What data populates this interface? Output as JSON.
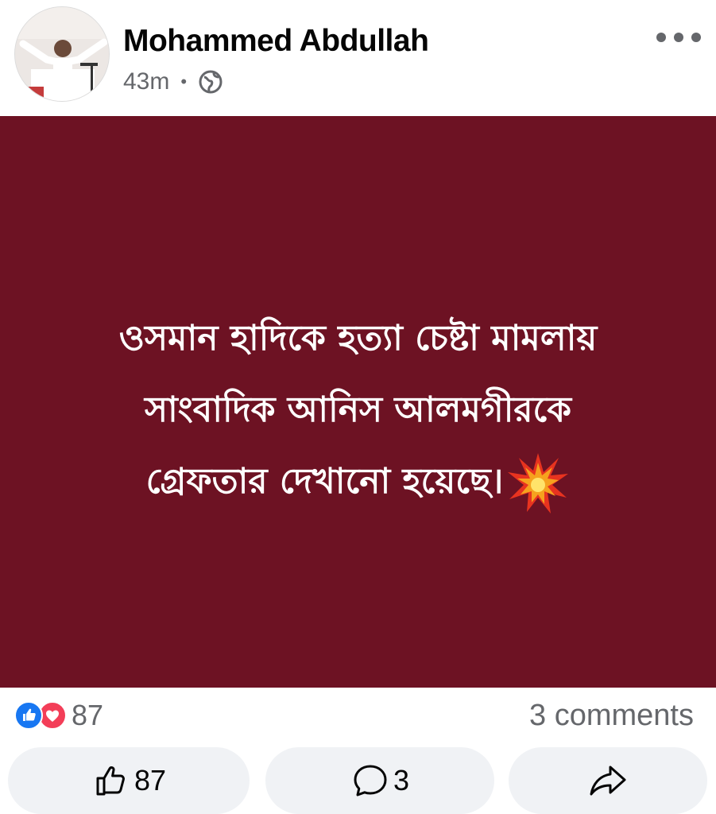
{
  "post": {
    "author_name": "Mohammed Abdullah",
    "timestamp": "43m",
    "separator": "•",
    "privacy_icon": "globe-icon",
    "more_icon": "more-horizontal-icon",
    "background_color": "#6d1223",
    "text_lines": [
      "ওসমান হাদিকে হত্যা চেষ্টা মামলায়",
      "সাংবাদিক আনিস আলমগীরকে",
      "গ্রেফতার দেখানো হয়েছে।"
    ],
    "trailing_emoji": "collision-emoji"
  },
  "stats": {
    "reaction_icons": [
      "like-reaction-icon",
      "love-reaction-icon"
    ],
    "reaction_count": "87",
    "comments_label": "3 comments"
  },
  "actions": {
    "like_count": "87",
    "comment_count": "3",
    "share_icon": "share-arrow-icon"
  },
  "colors": {
    "like_blue": "#1877f2",
    "love_red": "#f33e58",
    "secondary_text": "#65676b",
    "button_bg": "#f0f2f5"
  }
}
